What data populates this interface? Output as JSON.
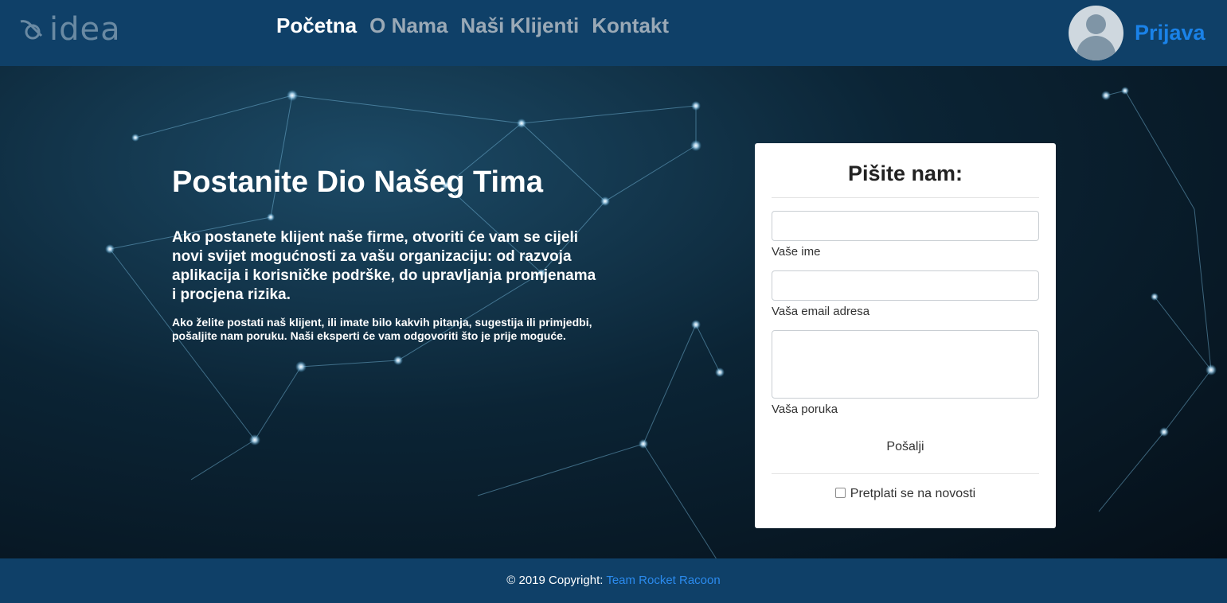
{
  "header": {
    "logo_text": "idea",
    "nav": [
      {
        "label": "Početna",
        "active": true
      },
      {
        "label": "O Nama",
        "active": false
      },
      {
        "label": "Naši Klijenti",
        "active": false
      },
      {
        "label": "Kontakt",
        "active": false
      }
    ],
    "login_label": "Prijava"
  },
  "hero": {
    "title": "Postanite Dio Našeg Tima",
    "lead": "Ako postanete klijent naše firme, otvoriti će vam se cijeli novi svijet mogućnosti za vašu organizaciju: od razvoja aplikacija i korisničke podrške, do upravljanja promjenama i procjena rizika.",
    "small": "Ako želite postati naš klijent, ili imate bilo kakvih pitanja, sugestija ili primjedbi, pošaljite nam poruku. Naši eksperti će vam odgovoriti što je prije moguće."
  },
  "form": {
    "title": "Pišite nam:",
    "name_label": "Vaše ime",
    "name_value": "",
    "email_label": "Vaša email adresa",
    "email_value": "",
    "message_label": "Vaša poruka",
    "message_value": "",
    "submit_label": "Pošalji",
    "subscribe_label": "Pretplati se na novosti",
    "subscribe_checked": false
  },
  "footer": {
    "copyright": "© 2019 Copyright:",
    "team": "Team Rocket Racoon"
  },
  "colors": {
    "header_bg": "#0f4068",
    "login": "#1a82e8",
    "footer_link": "#2b8bef"
  }
}
